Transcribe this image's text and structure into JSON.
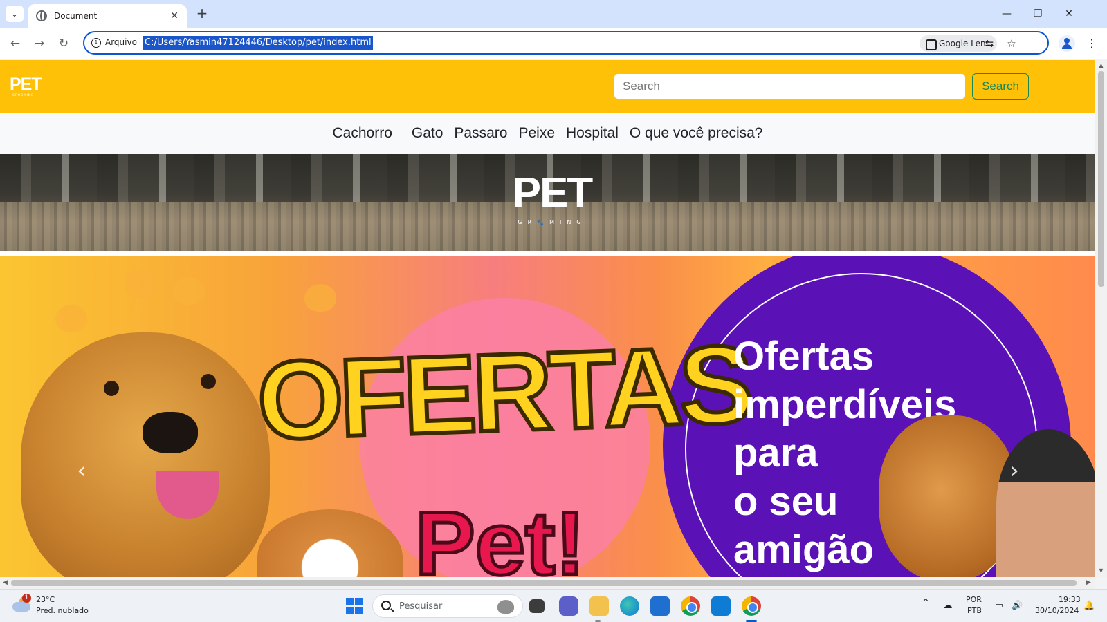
{
  "browser": {
    "tab_title": "Document",
    "tab_close": "✕",
    "new_tab": "+",
    "window_controls": {
      "minimize": "—",
      "restore": "❐",
      "close": "✕"
    },
    "nav": {
      "back": "←",
      "forward": "→",
      "reload": "↻"
    },
    "address": {
      "scheme_label": "Arquivo",
      "url": "C:/Users/Yasmin47124446/Desktop/pet/index.html",
      "lens_label": "Google Lens"
    },
    "icons": [
      "tab-menu-icon",
      "info-icon",
      "google-lens-icon",
      "translate-icon",
      "star-icon",
      "profile-icon",
      "menu-dots-icon"
    ]
  },
  "site": {
    "logo": {
      "brand": "PET",
      "sub": "GROOMING"
    },
    "search": {
      "placeholder": "Search",
      "button_label": "Search"
    },
    "nav_links": [
      "Cachorro",
      "Gato",
      "Passaro",
      "Peixe",
      "Hospital",
      "O que você precisa?"
    ],
    "hero_logo": {
      "brand": "PET",
      "sub": "GR🐾MING"
    },
    "carousel": {
      "title": "OFERTAS",
      "subtitle": "Pet!",
      "promo_lines": [
        "Ofertas",
        "imperdíveis",
        "para",
        "o seu",
        "amigão"
      ],
      "prev": "‹",
      "next": "›"
    },
    "colors": {
      "header": "#ffc107",
      "search_button": "#198754",
      "promo_circle": "#5a12b7"
    }
  },
  "taskbar": {
    "weather": {
      "badge": "1",
      "temp": "23°C",
      "desc": "Pred. nublado"
    },
    "search_placeholder": "Pesquisar",
    "tray": {
      "lang1": "POR",
      "lang2": "PTB",
      "time": "19:33",
      "date": "30/10/2024",
      "chevron": "^"
    },
    "apps": [
      "task-view-icon",
      "teams-icon",
      "file-explorer-icon",
      "edge-icon",
      "microsoft-store-icon",
      "chrome-icon",
      "vscode-icon",
      "chrome-active-icon"
    ]
  }
}
